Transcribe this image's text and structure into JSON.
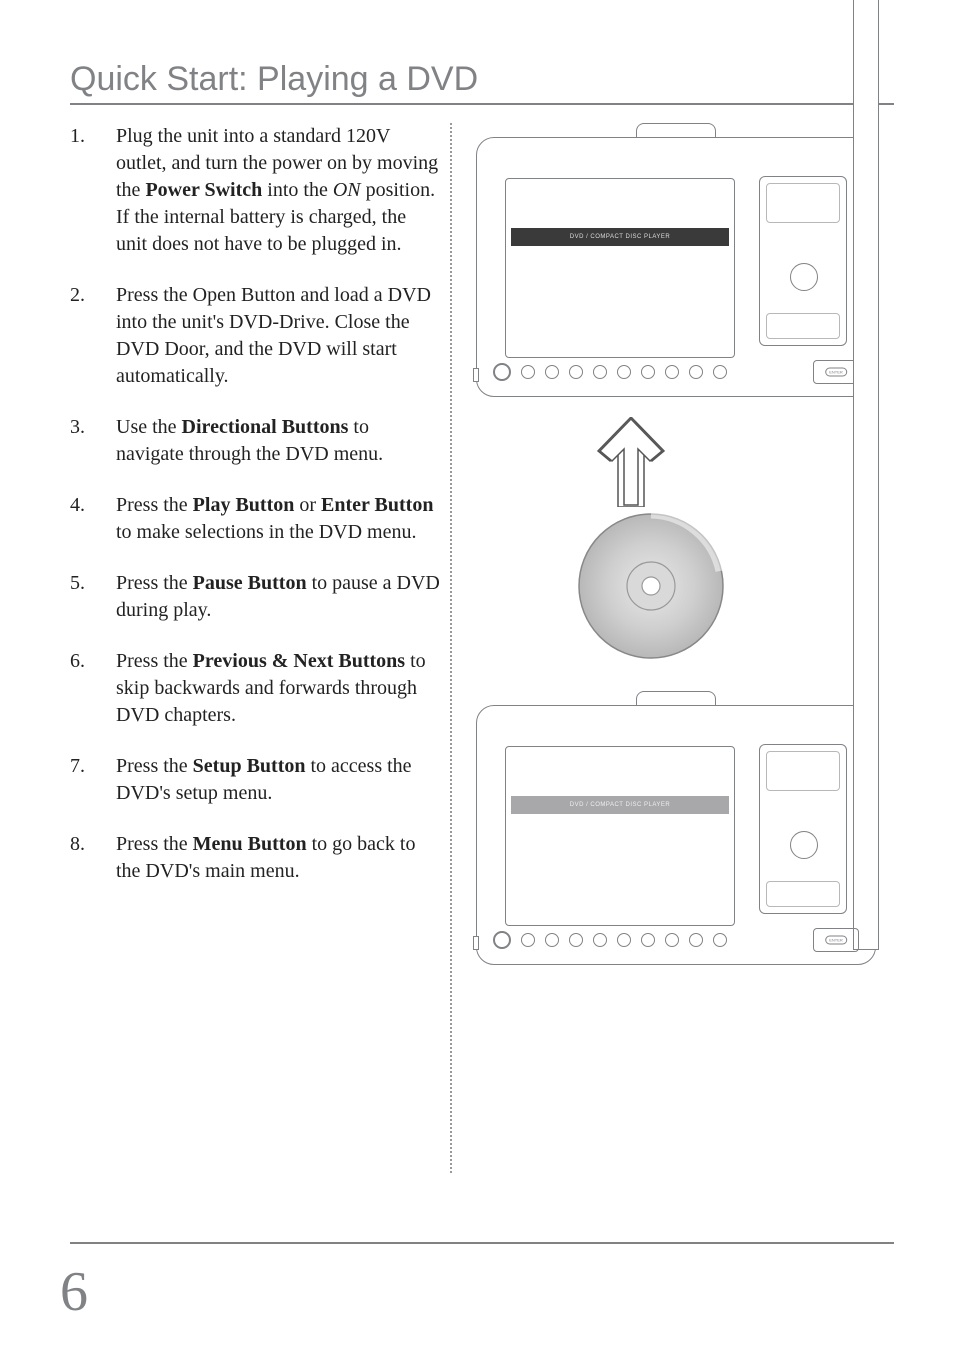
{
  "title": "Quick Start: Playing a DVD",
  "page_number": "6",
  "device_bar_label": "DVD / COMPACT DISC PLAYER",
  "steps": [
    {
      "pre": "Plug the unit into a standard 120V outlet, and turn the power on by moving the ",
      "bold1": "Power Switch",
      "mid1": " into the ",
      "ital": "ON",
      "post": " position.  If the internal battery is charged, the unit does not have to be plugged in."
    },
    {
      "pre": "Press the Open Button and load a DVD into the unit's DVD-Drive.  Close the DVD Door, and the DVD will start automatically.",
      "bold1": "",
      "mid1": "",
      "ital": "",
      "post": ""
    },
    {
      "pre": "Use the ",
      "bold1": "Directional Buttons",
      "mid1": " to navigate through the DVD menu.",
      "ital": "",
      "post": ""
    },
    {
      "pre": "Press the ",
      "bold1": "Play Button",
      "mid1": " or ",
      "bold2": "Enter Button",
      "post": " to make selections in the DVD menu.",
      "ital": ""
    },
    {
      "pre": "Press the ",
      "bold1": "Pause Button",
      "mid1": " to pause a DVD during play.",
      "ital": "",
      "post": ""
    },
    {
      "pre": "Press the ",
      "bold1": "Previous & Next Buttons",
      "mid1": " to skip backwards and forwards through DVD chapters.",
      "ital": "",
      "post": ""
    },
    {
      "pre": "Press the ",
      "bold1": "Setup Button",
      "mid1": " to access the DVD's setup menu.",
      "ital": "",
      "post": ""
    },
    {
      "pre": "Press the ",
      "bold1": "Menu Button",
      "mid1": " to go back to the DVD's main menu.",
      "ital": "",
      "post": ""
    }
  ]
}
